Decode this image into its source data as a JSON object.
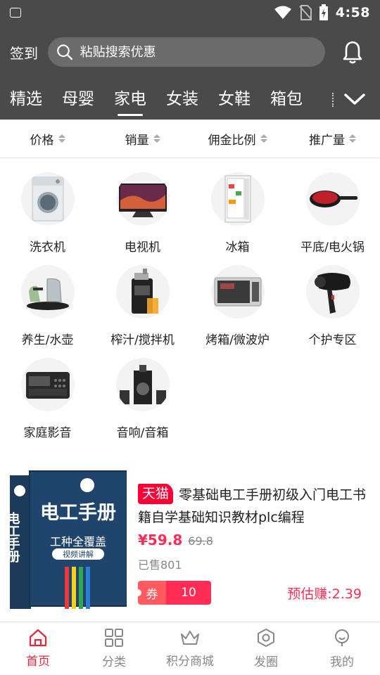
{
  "status_bar": {
    "time": "4:58"
  },
  "header": {
    "signin_label": "签到",
    "search_placeholder": "粘贴搜索优惠",
    "tabs": [
      {
        "label": "精选"
      },
      {
        "label": "母婴"
      },
      {
        "label": "家电",
        "active": true
      },
      {
        "label": "女装"
      },
      {
        "label": "女鞋"
      },
      {
        "label": "箱包"
      }
    ]
  },
  "sort_bar": {
    "items": [
      {
        "label": "价格"
      },
      {
        "label": "销量"
      },
      {
        "label": "佣金比例"
      },
      {
        "label": "推广量"
      }
    ]
  },
  "categories": [
    {
      "label": "洗衣机",
      "icon": "washing-machine"
    },
    {
      "label": "电视机",
      "icon": "television"
    },
    {
      "label": "冰箱",
      "icon": "refrigerator"
    },
    {
      "label": "平底/电火锅",
      "icon": "frying-pan"
    },
    {
      "label": "养生/水壶",
      "icon": "kettle"
    },
    {
      "label": "榨汁/搅拌机",
      "icon": "juicer"
    },
    {
      "label": "烤箱/微波炉",
      "icon": "microwave"
    },
    {
      "label": "个护专区",
      "icon": "hair-dryer"
    },
    {
      "label": "家庭影音",
      "icon": "radio"
    },
    {
      "label": "音响/音箱",
      "icon": "speaker"
    }
  ],
  "product": {
    "platform_badge": "天猫",
    "title": "零基础电工手册初级入门电工书籍自学基础知识教材plc编程",
    "price": "¥59.8",
    "original_price": "69.8",
    "sold": "已售801",
    "coupon_label": "券",
    "coupon_value": "10",
    "estimated_earn": "预估赚:2.39",
    "image": {
      "book_title": "电工手册",
      "spine_text": "电工手册",
      "subtitle": "工种全覆盖",
      "video_badge": "视频讲解"
    }
  },
  "bottom_nav": [
    {
      "label": "首页",
      "icon": "home",
      "active": true
    },
    {
      "label": "分类",
      "icon": "grid"
    },
    {
      "label": "积分商城",
      "icon": "crown"
    },
    {
      "label": "发圈",
      "icon": "hexagon"
    },
    {
      "label": "我的",
      "icon": "user"
    }
  ],
  "colors": {
    "header_bg": "#4a4a4a",
    "accent": "#ff2d55",
    "nav_active": "#e8253b"
  }
}
